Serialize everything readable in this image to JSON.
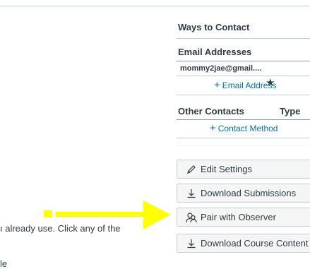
{
  "left": {
    "text_line1": "ı already use. Click any of the",
    "text_line2": "le"
  },
  "sidebar": {
    "ways_title": "Ways to Contact",
    "email_title": "Email Addresses",
    "email_value": "mommy2jae@gmail....",
    "add_email": "Email Address",
    "other_title": "Other Contacts",
    "type_header": "Type",
    "add_contact": "Contact Method"
  },
  "buttons": [
    {
      "label": "Edit Settings",
      "icon": "pencil-icon"
    },
    {
      "label": "Download Submissions",
      "icon": "download-icon"
    },
    {
      "label": "Pair with Observer",
      "icon": "observer-pair-icon"
    },
    {
      "label": "Download Course Content",
      "icon": "download-icon"
    }
  ],
  "colors": {
    "annotation_arrow": "#ffff00",
    "link": "#0770a3",
    "text": "#2d3b45",
    "button_bg": "#f5f5f5"
  }
}
